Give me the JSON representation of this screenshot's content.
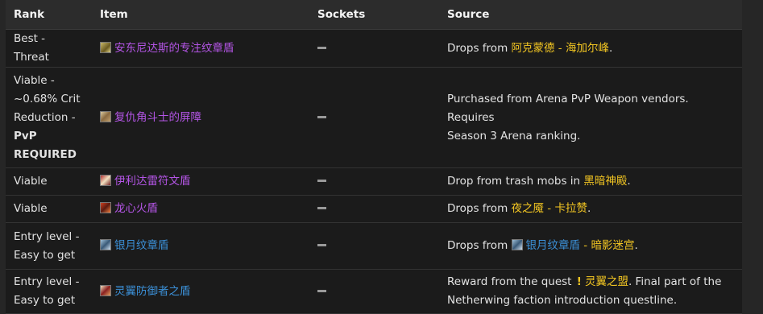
{
  "headers": {
    "rank": "Rank",
    "item": "Item",
    "sockets": "Sockets",
    "source": "Source"
  },
  "rows": [
    {
      "rank": "Best - Threat",
      "item": "安东尼达斯的专注纹章盾",
      "item_color": "#b455e6",
      "icon": "shield-icon",
      "source_prefix": "Drops from ",
      "source_link": "阿克蒙德",
      "source_sep": " - ",
      "source_link2": "海加尔峰",
      "source_suffix": "."
    },
    {
      "rank_lines": [
        "Viable -",
        "~0.68% Crit",
        "Reduction -"
      ],
      "rank_bold_lines": [
        "PvP",
        "REQUIRED"
      ],
      "item": "复仇角斗士的屏障",
      "item_color": "#b455e6",
      "icon": "shield-icon",
      "source_line1": "Purchased from Arena PvP Weapon vendors. Requires",
      "source_line2": "Season 3 Arena ranking."
    },
    {
      "rank": "Viable",
      "item": "伊利达雷符文盾",
      "item_color": "#b455e6",
      "icon": "shield-icon",
      "source_prefix": "Drop from trash mobs in ",
      "source_link": "黑暗神殿",
      "source_suffix": "."
    },
    {
      "rank": "Viable",
      "item": "龙心火盾",
      "item_color": "#b455e6",
      "icon": "shield-icon",
      "source_prefix": "Drops from ",
      "source_link": "夜之魇",
      "source_sep": " - ",
      "source_link2": "卡拉赞",
      "source_suffix": "."
    },
    {
      "rank_lines": [
        "Entry level -",
        "Easy to get"
      ],
      "item": "银月纹章盾",
      "item_color": "#3b8fd6",
      "icon": "shield-icon",
      "source_prefix": "Drops from ",
      "source_item_link": "银月纹章盾",
      "source_sep": " - ",
      "source_link2": "暗影迷宫",
      "source_suffix": "."
    },
    {
      "rank_lines": [
        "Entry level -",
        "Easy to get"
      ],
      "item": "灵翼防御者之盾",
      "item_color": "#3b8fd6",
      "icon": "shield-icon",
      "source_line1_prefix": "Reward from the quest ",
      "quest_icon": "!",
      "source_link": "灵翼之盟",
      "source_line1_suffix": ". Final part of the",
      "source_line2": "Netherwing faction introduction questline."
    }
  ],
  "sockets_value": "—",
  "colors": {
    "epic": "#b455e6",
    "rare": "#3b8fd6",
    "link": "#f3c622"
  }
}
